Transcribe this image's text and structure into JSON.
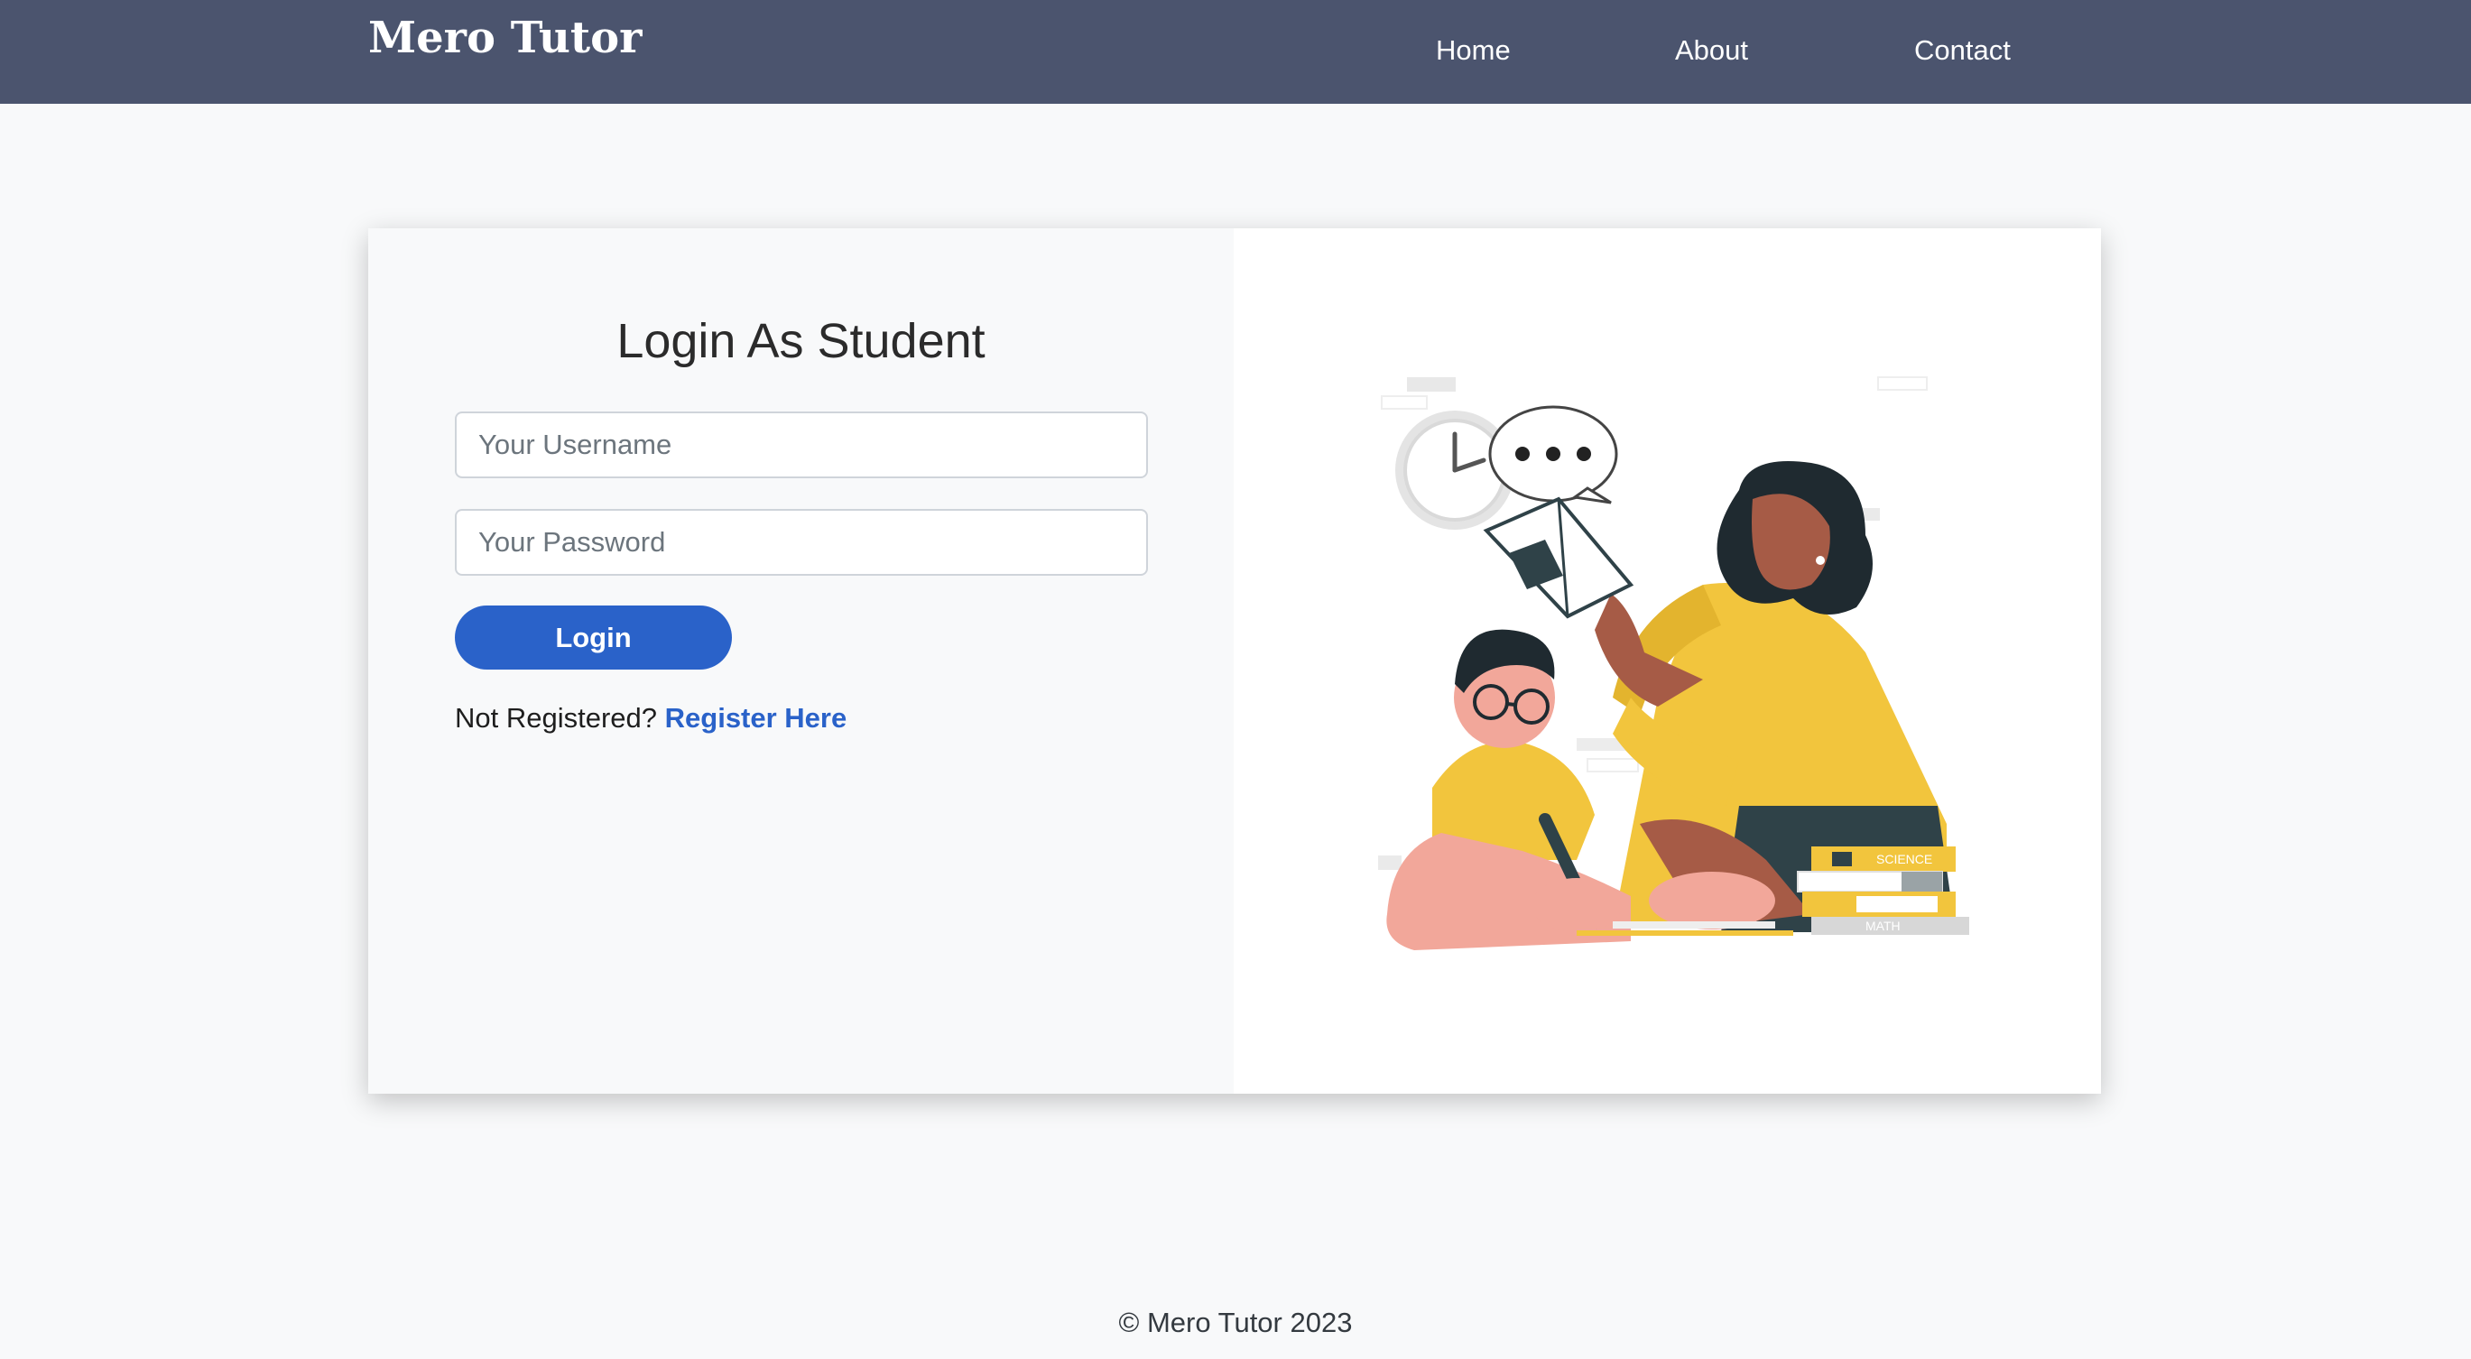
{
  "nav": {
    "brand": "Mero Tutor",
    "links": [
      {
        "label": "Home"
      },
      {
        "label": "About"
      },
      {
        "label": "Contact"
      }
    ]
  },
  "login": {
    "title": "Login As Student",
    "username_placeholder": "Your Username",
    "password_placeholder": "Your Password",
    "button_label": "Login",
    "not_registered": "Not Registered?",
    "register_link": "Register Here"
  },
  "illustration": {
    "book_labels": [
      "SCIENCE",
      "MATH"
    ],
    "icon": "teacher-student-illustration"
  },
  "footer": {
    "copyright": "© Mero Tutor 2023"
  },
  "colors": {
    "navbar": "#4b546e",
    "primary": "#2a62c9",
    "page_bg": "#f8f9fa",
    "accent_yellow": "#f2c53d"
  }
}
